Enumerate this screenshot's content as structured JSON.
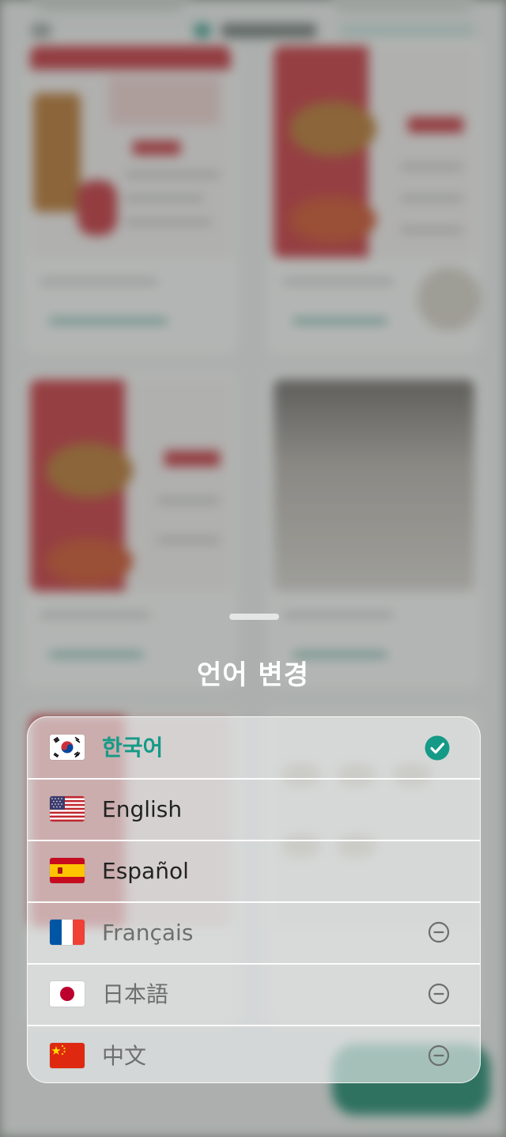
{
  "sheet": {
    "title": "언어 변경"
  },
  "languages": [
    {
      "flag": "kr",
      "label": "한국어",
      "state": "selected",
      "icon": "check-circle-icon",
      "accent": "#159a87"
    },
    {
      "flag": "us",
      "label": "English",
      "state": "available"
    },
    {
      "flag": "es",
      "label": "Español",
      "state": "available"
    },
    {
      "flag": "fr",
      "label": "Français",
      "state": "unavailable",
      "icon": "minus-circle-icon"
    },
    {
      "flag": "jp",
      "label": "日本語",
      "state": "unavailable",
      "icon": "minus-circle-icon"
    },
    {
      "flag": "cn",
      "label": "中文",
      "state": "unavailable",
      "icon": "minus-circle-icon"
    }
  ],
  "colors": {
    "accent": "#159a87",
    "muted_text": "#6b6f6d"
  }
}
